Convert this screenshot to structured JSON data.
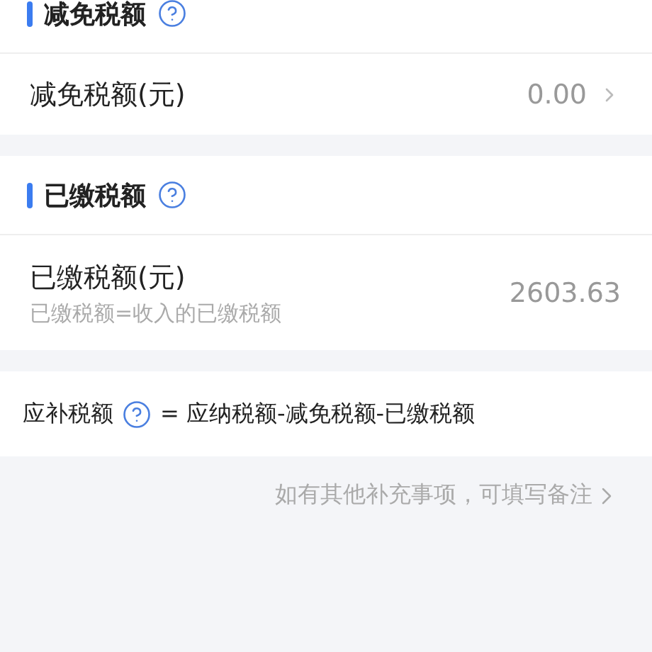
{
  "sections": [
    {
      "title": "减免税额",
      "rows": [
        {
          "kind": "link",
          "label": "减免税额(元)",
          "value": "0.00"
        }
      ]
    },
    {
      "title": "已缴税额",
      "rows": [
        {
          "kind": "static",
          "label": "已缴税额(元)",
          "hint": "已缴税额=收入的已缴税额",
          "value": "2603.63"
        }
      ]
    }
  ],
  "formula": {
    "label": "应补税额",
    "text": "= 应纳税额-减免税额-已缴税额"
  },
  "remark_link": "如有其他补充事项，可填写备注"
}
